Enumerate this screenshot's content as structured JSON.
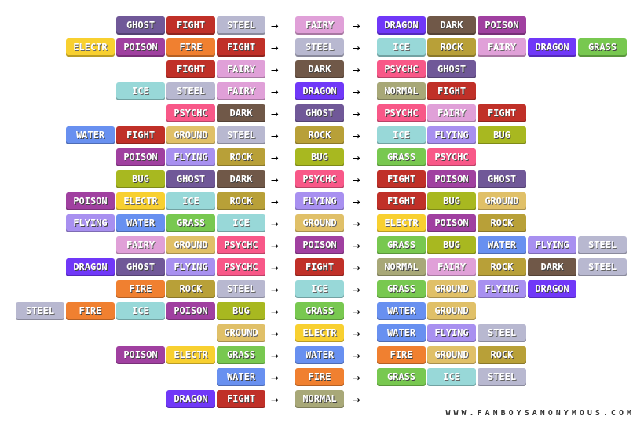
{
  "type_colors": {
    "GHOST": "#705898",
    "FIGHT": "#C03028",
    "STEEL": "#B8B8D0",
    "FAIRY": "#E0A0D8",
    "DRAGON": "#7038F8",
    "DARK": "#705848",
    "POISON": "#A040A0",
    "ELECTR": "#F8D030",
    "FIRE": "#F08030",
    "ICE": "#98D8D8",
    "ROCK": "#B8A038",
    "GRASS": "#78C850",
    "PSYCHC": "#F85888",
    "NORMAL": "#A8A878",
    "WATER": "#6890F0",
    "FLYING": "#A890F0",
    "GROUND": "#E0C068",
    "BUG": "#A8B820"
  },
  "arrow": "→",
  "rows": [
    {
      "left": [
        "GHOST",
        "FIGHT",
        "STEEL"
      ],
      "middle": "FAIRY",
      "right": [
        "DRAGON",
        "DARK",
        "POISON"
      ]
    },
    {
      "left": [
        "ELECTR",
        "POISON",
        "FIRE",
        "FIGHT"
      ],
      "middle": "STEEL",
      "right": [
        "ICE",
        "ROCK",
        "FAIRY",
        "DRAGON",
        "GRASS"
      ]
    },
    {
      "left": [
        "FIGHT",
        "FAIRY"
      ],
      "middle": "DARK",
      "right": [
        "PSYCHC",
        "GHOST"
      ]
    },
    {
      "left": [
        "ICE",
        "STEEL",
        "FAIRY"
      ],
      "middle": "DRAGON",
      "right": [
        "NORMAL",
        "FIGHT"
      ]
    },
    {
      "left": [
        "PSYCHC",
        "DARK"
      ],
      "middle": "GHOST",
      "right": [
        "PSYCHC",
        "FAIRY",
        "FIGHT"
      ]
    },
    {
      "left": [
        "WATER",
        "FIGHT",
        "GROUND",
        "STEEL"
      ],
      "middle": "ROCK",
      "right": [
        "ICE",
        "FLYING",
        "BUG"
      ]
    },
    {
      "left": [
        "POISON",
        "FLYING",
        "ROCK"
      ],
      "middle": "BUG",
      "right": [
        "GRASS",
        "PSYCHC"
      ]
    },
    {
      "left": [
        "BUG",
        "GHOST",
        "DARK"
      ],
      "middle": "PSYCHC",
      "right": [
        "FIGHT",
        "POISON",
        "GHOST"
      ]
    },
    {
      "left": [
        "POISON",
        "ELECTR",
        "ICE",
        "ROCK"
      ],
      "middle": "FLYING",
      "right": [
        "FIGHT",
        "BUG",
        "GROUND"
      ]
    },
    {
      "left": [
        "FLYING",
        "WATER",
        "GRASS",
        "ICE"
      ],
      "middle": "GROUND",
      "right": [
        "ELECTR",
        "POISON",
        "ROCK"
      ]
    },
    {
      "left": [
        "FAIRY",
        "GROUND",
        "PSYCHC"
      ],
      "middle": "POISON",
      "right": [
        "GRASS",
        "BUG",
        "WATER",
        "FLYING",
        "STEEL"
      ]
    },
    {
      "left": [
        "DRAGON",
        "GHOST",
        "FLYING",
        "PSYCHC"
      ],
      "middle": "FIGHT",
      "right": [
        "NORMAL",
        "FAIRY",
        "ROCK",
        "DARK",
        "STEEL"
      ]
    },
    {
      "left": [
        "FIRE",
        "ROCK",
        "STEEL"
      ],
      "middle": "ICE",
      "right": [
        "GRASS",
        "GROUND",
        "FLYING",
        "DRAGON"
      ]
    },
    {
      "left": [
        "STEEL",
        "FIRE",
        "ICE",
        "POISON",
        "BUG"
      ],
      "middle": "GRASS",
      "right": [
        "WATER",
        "GROUND"
      ]
    },
    {
      "left": [
        "GROUND"
      ],
      "middle": "ELECTR",
      "right": [
        "WATER",
        "FLYING",
        "STEEL"
      ]
    },
    {
      "left": [
        "POISON",
        "ELECTR",
        "GRASS"
      ],
      "middle": "WATER",
      "right": [
        "FIRE",
        "GROUND",
        "ROCK"
      ]
    },
    {
      "left": [
        "WATER"
      ],
      "middle": "FIRE",
      "right": [
        "GRASS",
        "ICE",
        "STEEL"
      ]
    },
    {
      "left": [
        "DRAGON",
        "FIGHT"
      ],
      "middle": "NORMAL",
      "right": []
    }
  ],
  "footer": "WWW.FANBOYSANONYMOUS.COM"
}
